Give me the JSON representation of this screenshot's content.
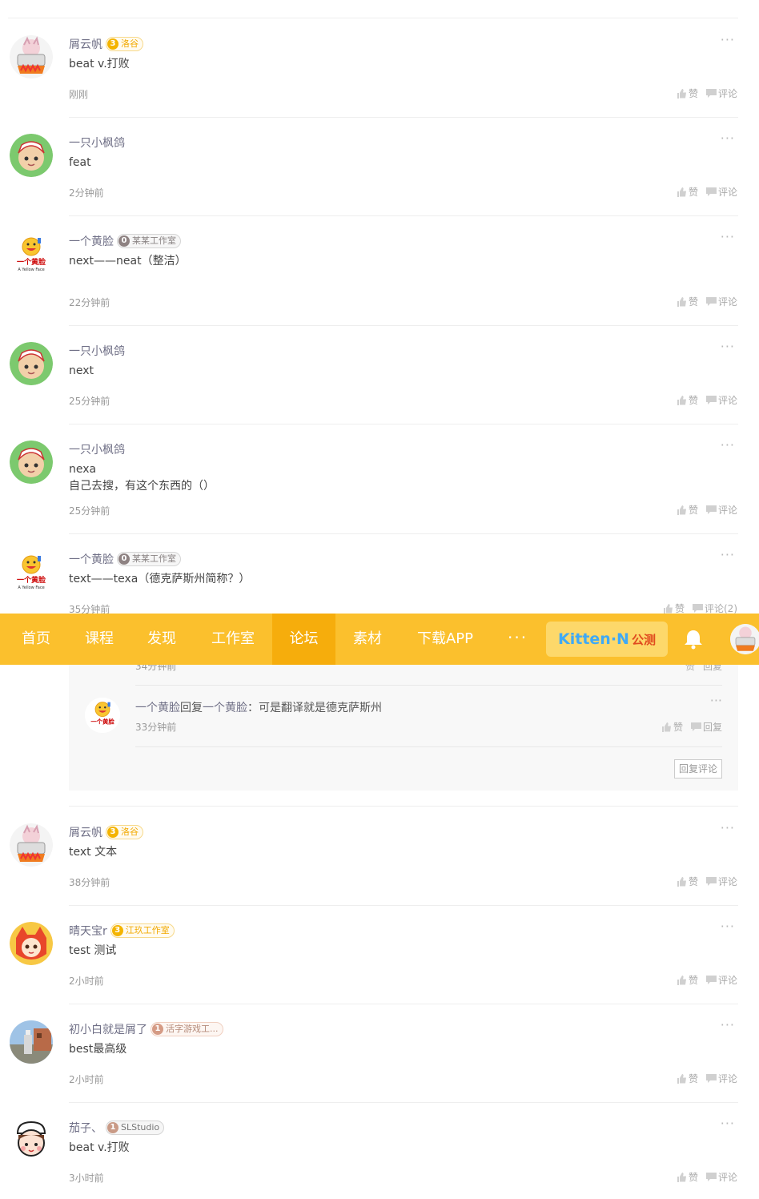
{
  "navbar": {
    "items": [
      {
        "label": "首页"
      },
      {
        "label": "课程"
      },
      {
        "label": "发现"
      },
      {
        "label": "工作室"
      },
      {
        "label": "论坛"
      },
      {
        "label": "素材"
      },
      {
        "label": "下载APP"
      }
    ],
    "active_item": "论坛",
    "more_label": "···",
    "promo_logo": "Kitten·N",
    "promo_tag": "公测",
    "accent_color": "#fbc02d",
    "active_color": "#f6ad0c"
  },
  "comments": [
    {
      "user": "屑云帆",
      "level": "3",
      "studio": "洛谷",
      "content": "beat v.打败",
      "time": "刚刚",
      "like": "赞",
      "comment": "评论",
      "more": "···",
      "avatar": "cat-pot"
    },
    {
      "user": "一只小枫鸽",
      "level": "",
      "studio": "",
      "content": "feat",
      "time": "2分钟前",
      "like": "赞",
      "comment": "评论",
      "more": "···",
      "avatar": "monkey-face"
    },
    {
      "user": "一个黄脸",
      "level": "0",
      "studio": "某某工作室",
      "content": "next——neat（整洁）",
      "time": "22分钟前",
      "like": "赞",
      "comment": "评论",
      "more": "···",
      "avatar": "yellow-face-logo"
    },
    {
      "user": "一只小枫鸽",
      "level": "",
      "studio": "",
      "content": "next",
      "time": "25分钟前",
      "like": "赞",
      "comment": "评论",
      "more": "···",
      "avatar": "monkey-face"
    },
    {
      "user": "一只小枫鸽",
      "level": "",
      "studio": "",
      "content": "nexa\n自己去搜，有这个东西的（）",
      "time": "25分钟前",
      "like": "赞",
      "comment": "评论",
      "more": "···",
      "avatar": "monkey-face"
    },
    {
      "user": "一个黄脸",
      "level": "0",
      "studio": "某某工作室",
      "content": "text——texa（德克萨斯州简称？）",
      "time": "35分钟前",
      "like": "赞",
      "comment": "评论(2)",
      "more": "···",
      "avatar": "yellow-face-logo"
    },
    {
      "user": "屑云帆",
      "level": "3",
      "studio": "洛谷",
      "content": "text 文本",
      "time": "38分钟前",
      "like": "赞",
      "comment": "评论",
      "more": "···",
      "avatar": "cat-pot"
    },
    {
      "user": "晴天宝r",
      "level": "3",
      "studio": "江玖工作室",
      "content": "test 测试",
      "time": "2小时前",
      "like": "赞",
      "comment": "评论",
      "more": "···",
      "avatar": "fox-girl"
    },
    {
      "user": "初小白就是屑了",
      "level": "1",
      "studio": "活字游戏工...",
      "content": "best最高级",
      "time": "2小时前",
      "like": "赞",
      "comment": "评论",
      "more": "···",
      "avatar": "minecraft-scene"
    },
    {
      "user": "茄子、",
      "level": "1",
      "studio": "SLStudio",
      "content": "beat v.打败",
      "time": "3小时前",
      "like": "赞",
      "comment": "评论",
      "more": "···",
      "avatar": "chef-boy"
    }
  ],
  "replies": {
    "partial": {
      "time": "34分钟前",
      "like": "赞",
      "reply": "回复"
    },
    "items": [
      {
        "user": "一个黄脸",
        "action": "回复",
        "target": "一个黄脸",
        "text": "：可是翻译就是德克萨斯州",
        "time": "33分钟前",
        "like": "赞",
        "reply": "回复",
        "more": "···"
      }
    ],
    "reply_button": "回复评论"
  }
}
